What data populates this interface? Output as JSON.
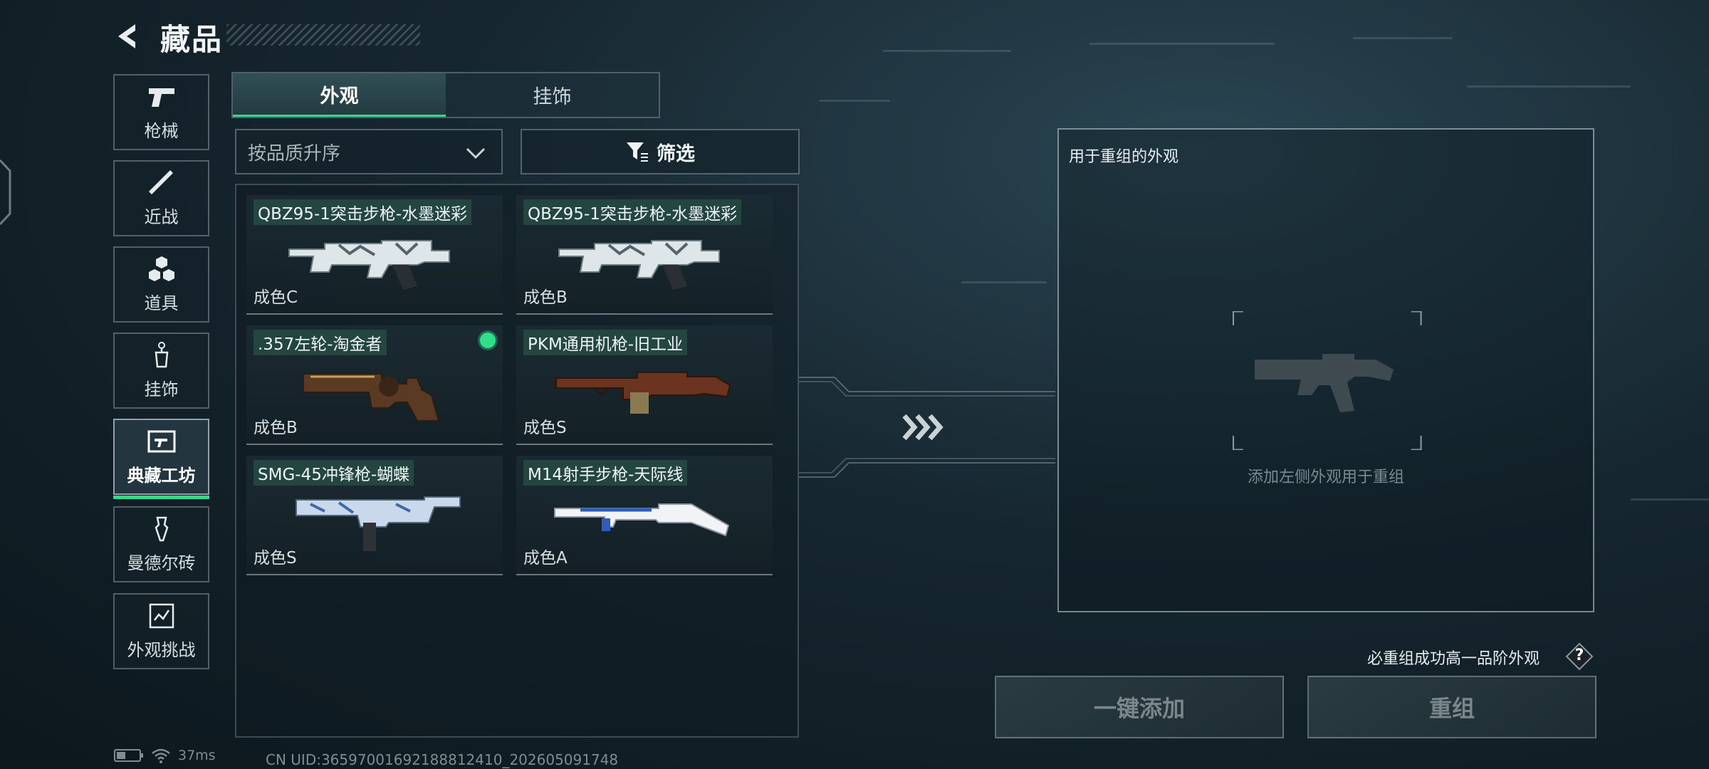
{
  "header": {
    "title": "藏品"
  },
  "sidebar": {
    "items": [
      {
        "label": "枪械",
        "icon": "pistol-icon"
      },
      {
        "label": "近战",
        "icon": "knife-icon"
      },
      {
        "label": "道具",
        "icon": "cubes-icon"
      },
      {
        "label": "挂饰",
        "icon": "charm-icon"
      },
      {
        "label": "典藏工坊",
        "icon": "workshop-icon",
        "active": true
      },
      {
        "label": "曼德尔砖",
        "icon": "brick-icon"
      },
      {
        "label": "外观挑战",
        "icon": "challenge-icon"
      }
    ]
  },
  "tabs": [
    {
      "label": "外观",
      "active": true
    },
    {
      "label": "挂饰"
    }
  ],
  "sort": {
    "label": "按品质升序"
  },
  "filter": {
    "label": "筛选"
  },
  "skins": [
    {
      "name": "QBZ95-1突击步枪-水墨迷彩",
      "grade": "成色C",
      "gun": "rifle-icon"
    },
    {
      "name": "QBZ95-1突击步枪-水墨迷彩",
      "grade": "成色B",
      "gun": "rifle-icon"
    },
    {
      "name": ".357左轮-淘金者",
      "grade": "成色B",
      "gun": "revolver-icon",
      "selected": true
    },
    {
      "name": "PKM通用机枪-旧工业",
      "grade": "成色S",
      "gun": "machine-gun-icon"
    },
    {
      "name": "SMG-45冲锋枪-蝴蝶",
      "grade": "成色S",
      "gun": "smg-icon"
    },
    {
      "name": "M14射手步枪-天际线",
      "grade": "成色A",
      "gun": "marksman-rifle-icon"
    }
  ],
  "recombine": {
    "title": "用于重组的外观",
    "placeholder": "添加左侧外观用于重组"
  },
  "guarantee_text": "必重组成功高一品阶外观",
  "help_label": "?",
  "buttons": {
    "add_all": "一键添加",
    "recombine": "重组"
  },
  "status": {
    "ping": "37ms",
    "uid": "CN UID:3659700169218881241​0_202605091748"
  },
  "colors": {
    "accent": "#3ad68a",
    "selected_dot": "#2ee08a"
  }
}
